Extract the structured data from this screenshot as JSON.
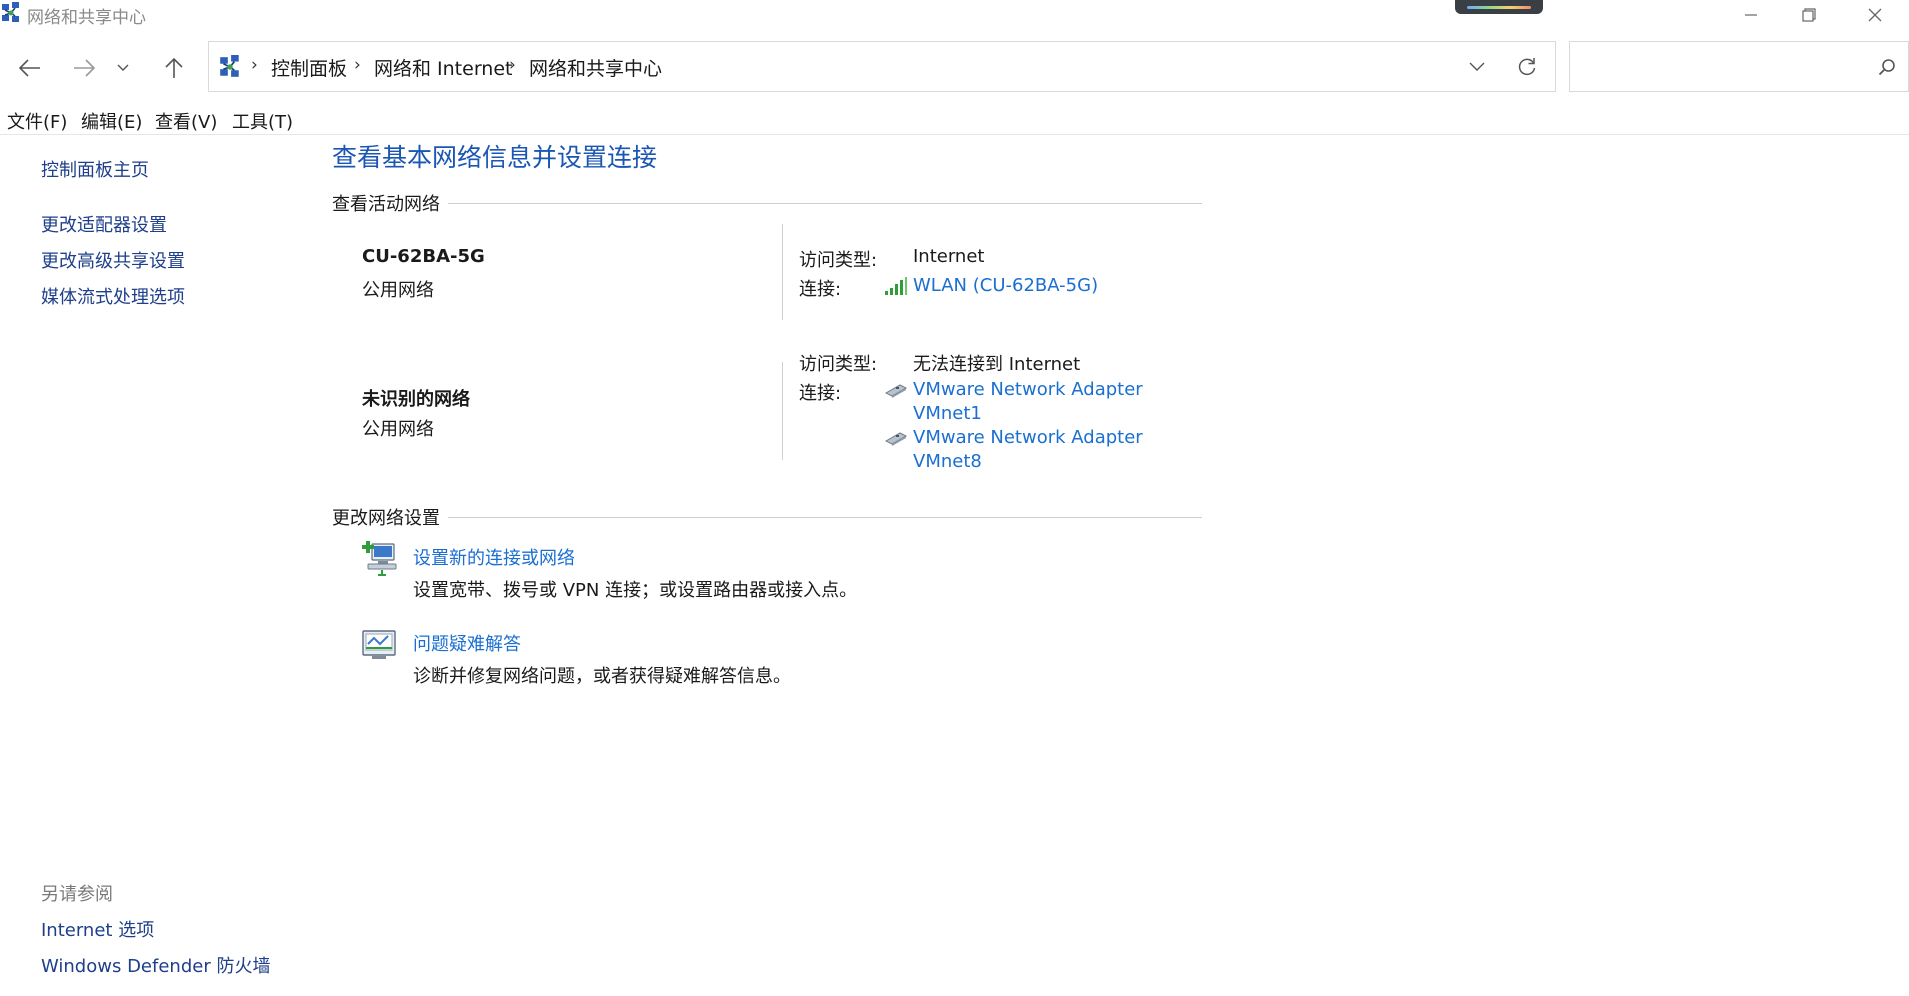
{
  "window": {
    "title": "网络和共享中心"
  },
  "address": {
    "crumbs": [
      "控制面板",
      "网络和 Internet",
      "网络和共享中心"
    ],
    "search_placeholder": ""
  },
  "menu": [
    "文件(F)",
    "编辑(E)",
    "查看(V)",
    "工具(T)"
  ],
  "sidebar": {
    "links": [
      "控制面板主页",
      "更改适配器设置",
      "更改高级共享设置",
      "媒体流式处理选项"
    ],
    "see_also_title": "另请参阅",
    "see_also": [
      "Internet 选项",
      "Windows Defender 防火墙"
    ]
  },
  "main": {
    "title": "查看基本网络信息并设置连接",
    "active_section": "查看活动网络",
    "networks": [
      {
        "name": "CU-62BA-5G",
        "type": "公用网络",
        "access_label": "访问类型:",
        "access_value": "Internet",
        "conn_label": "连接:",
        "connections": [
          "WLAN (CU-62BA-5G)"
        ]
      },
      {
        "name": "未识别的网络",
        "type": "公用网络",
        "access_label": "访问类型:",
        "access_value": "无法连接到 Internet",
        "conn_label": "连接:",
        "connections": [
          [
            "VMware Network Adapter",
            "VMnet1"
          ],
          [
            "VMware Network Adapter",
            "VMnet8"
          ]
        ]
      }
    ],
    "change_section": "更改网络设置",
    "tasks": [
      {
        "link": "设置新的连接或网络",
        "desc": "设置宽带、拨号或 VPN 连接；或设置路由器或接入点。"
      },
      {
        "link": "问题疑难解答",
        "desc": "诊断并修复网络问题，或者获得疑难解答信息。"
      }
    ]
  },
  "colors": {
    "link": "#1a6fd1",
    "title": "#1a56b3",
    "nav_link": "#1f3f8a",
    "wifi": "#2f9e3a"
  }
}
